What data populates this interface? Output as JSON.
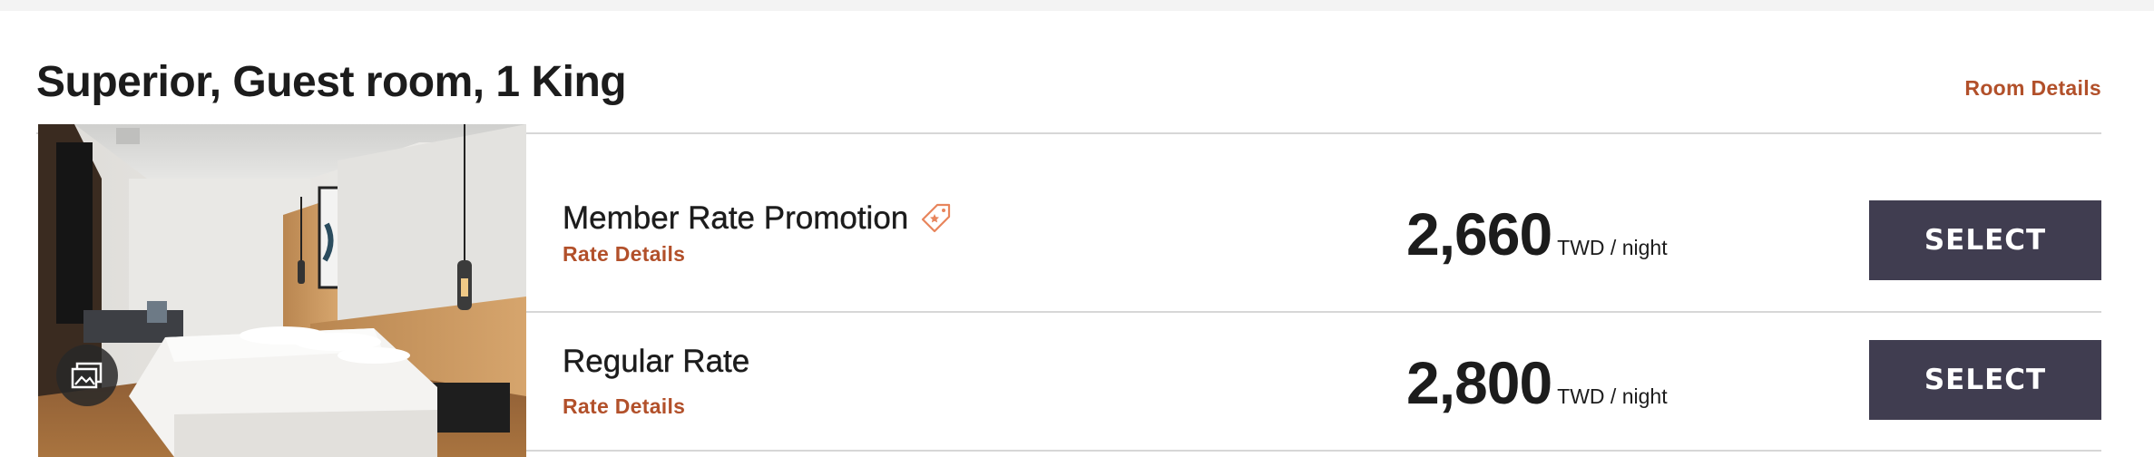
{
  "room": {
    "title": "Superior, Guest room, 1 King",
    "details_link": "Room Details",
    "image_icon": "photo-gallery-icon"
  },
  "rates": [
    {
      "name": "Member Rate Promotion",
      "badge_icon": "promotion-tag-icon",
      "details_link": "Rate Details",
      "price": "2,660",
      "unit": "TWD / night",
      "select_label": "SELECT"
    },
    {
      "name": "Regular Rate",
      "details_link": "Rate Details",
      "price": "2,800",
      "unit": "TWD / night",
      "select_label": "SELECT"
    }
  ],
  "colors": {
    "accent": "#b2502a",
    "button": "#403d50",
    "divider": "#d7d7d7",
    "background": "#f3f3f3"
  }
}
